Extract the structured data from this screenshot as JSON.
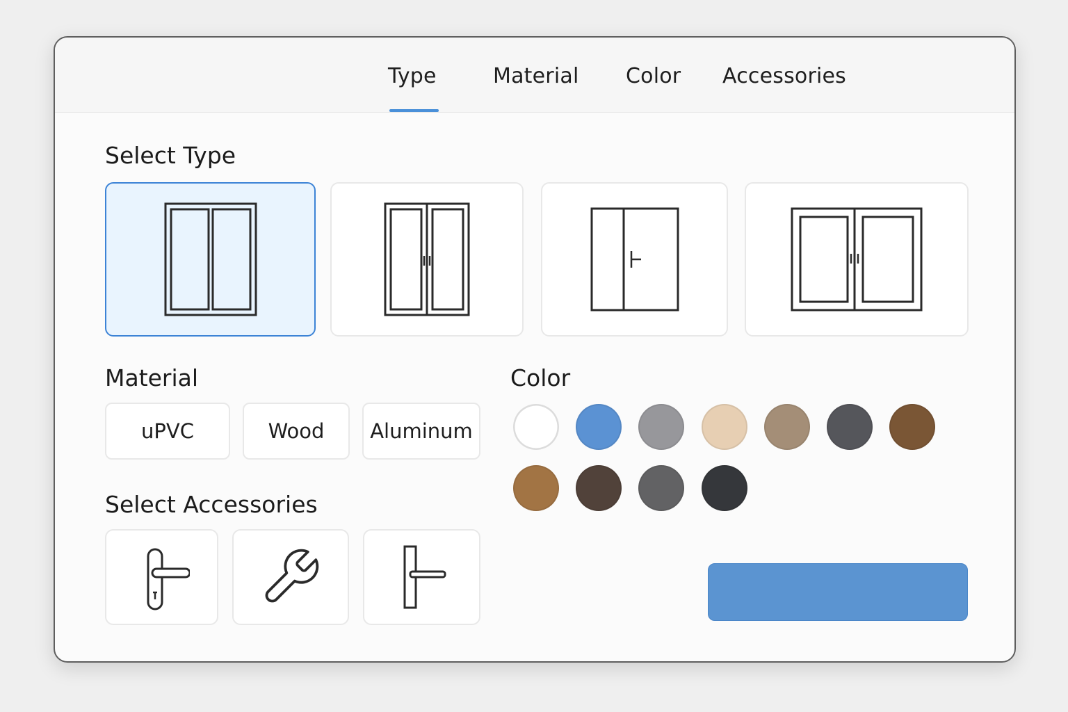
{
  "tabs": [
    {
      "label": "Type",
      "active": true
    },
    {
      "label": "Material",
      "active": false
    },
    {
      "label": "Color",
      "active": false
    },
    {
      "label": "Accessories",
      "active": false
    }
  ],
  "sections": {
    "type_title": "Select Type",
    "material_title": "Material",
    "color_title": "Color",
    "accessories_title": "Select Accessories"
  },
  "type_options": [
    {
      "icon": "double-casement-window-icon",
      "selected": true
    },
    {
      "icon": "double-door-with-handles-icon",
      "selected": false
    },
    {
      "icon": "door-with-sidelight-icon",
      "selected": false
    },
    {
      "icon": "sliding-window-icon",
      "selected": false
    }
  ],
  "materials": [
    "uPVC",
    "Wood",
    "Aluminum"
  ],
  "colors": [
    "#ffffff",
    "#5b92d3",
    "#97979b",
    "#e7cfb3",
    "#a48e77",
    "#55565b",
    "#7a5635",
    "#a27444",
    "#51423a",
    "#626264",
    "#35373b"
  ],
  "accessories": [
    {
      "icon": "door-handle-with-lock-icon"
    },
    {
      "icon": "wrench-icon"
    },
    {
      "icon": "lever-handle-icon"
    }
  ],
  "primary_button": {
    "label": ""
  },
  "accent_color": "#4a90d9"
}
